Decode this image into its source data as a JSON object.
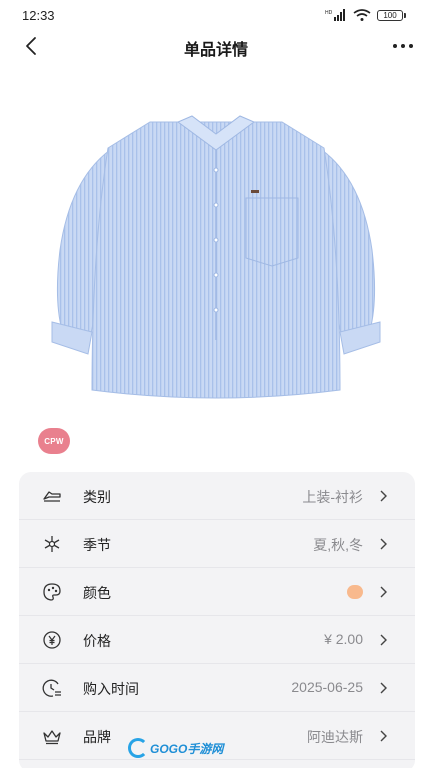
{
  "status_bar": {
    "time": "12:33",
    "network": "HD",
    "battery": "100"
  },
  "header": {
    "title": "单品详情"
  },
  "brand": {
    "logo_text": "CPW",
    "color": "#e9808e"
  },
  "details": [
    {
      "icon": "clothing-icon",
      "label": "类别",
      "value": "上装-衬衫"
    },
    {
      "icon": "snowflake-icon",
      "label": "季节",
      "value": "夏,秋,冬"
    },
    {
      "icon": "palette-icon",
      "label": "颜色",
      "value": "",
      "color": "#f8b98d"
    },
    {
      "icon": "yen-icon",
      "label": "价格",
      "value": "¥ 2.00"
    },
    {
      "icon": "clock-icon",
      "label": "购入时间",
      "value": "2025-06-25"
    },
    {
      "icon": "crown-icon",
      "label": "品牌",
      "value": "阿迪达斯"
    }
  ],
  "watermark": {
    "text": "GOGO手游网"
  },
  "colors": {
    "shirt": "#b9cdef",
    "card_bg": "#f3f3f5",
    "accent": "#e9808e"
  }
}
